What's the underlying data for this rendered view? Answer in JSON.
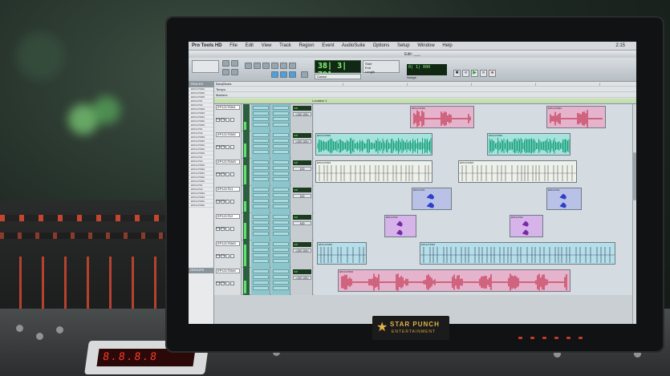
{
  "app": {
    "menu_items": [
      "Pro Tools HD",
      "File",
      "Edit",
      "View",
      "Track",
      "Region",
      "Event",
      "AudioSuite",
      "Options",
      "Setup",
      "Window",
      "Help"
    ],
    "clock": "2:15",
    "window_title": "Edit: ___"
  },
  "toolbar": {
    "counter_main": "38| 3| 791",
    "counter_side": [
      "Start",
      "End",
      "Length"
    ],
    "cursor_label": "Cursor",
    "nudge_label": "Nudge"
  },
  "tracklist": {
    "header": "TRACKS",
    "groups_header": "GROUPS"
  },
  "ruler": {
    "rows": [
      "Bars|Beats",
      "Tempo",
      "Markers"
    ],
    "marker_text": "Location 1"
  },
  "columns": [
    "INSERTS A-E",
    "INSERTS F-J"
  ],
  "tracks": [
    {
      "name": "EP1217DM1",
      "mode": "waveform",
      "vol": "vol",
      "pan": "<100 100>"
    },
    {
      "name": "EP1217DM2",
      "mode": "waveform",
      "vol": "vol",
      "pan": "<100 100>"
    },
    {
      "name": "EP1217DM3",
      "mode": "waveform",
      "vol": "vol",
      "pan": "100"
    },
    {
      "name": "EP1217D1",
      "mode": "waveform",
      "vol": "vol",
      "pan": "100"
    },
    {
      "name": "EP1217D2",
      "mode": "waveform",
      "vol": "vol",
      "pan": "100"
    },
    {
      "name": "EP1217DM3",
      "mode": "waveform",
      "vol": "vol",
      "pan": "<100 100>"
    },
    {
      "name": "EP1217DM4",
      "mode": "waveform",
      "vol": "vol",
      "pan": "<100 100>"
    }
  ],
  "brand": {
    "line1": "STAR PUNCH",
    "line2": "ENTERTAINMENT"
  },
  "colors": {
    "clip_pink": "#e6b3cc",
    "clip_teal": "#a7e3de",
    "clip_blue": "#b9c2e6",
    "clip_purple": "#d6b3e8",
    "clip_cyan": "#b5dfe8",
    "wave_red": "#c0304a",
    "wave_green": "#18a07a",
    "wave_blue": "#2c40c8"
  }
}
